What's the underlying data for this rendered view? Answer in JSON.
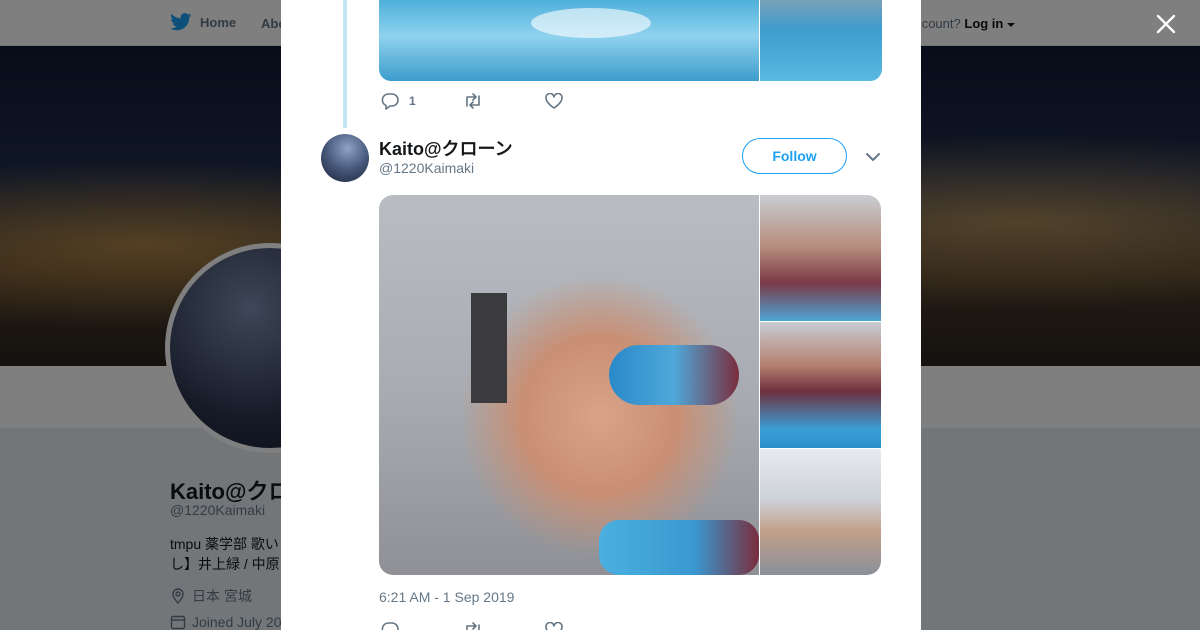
{
  "background_page": {
    "nav": {
      "home": "Home",
      "about": "Abo",
      "account_prompt": "ccount?",
      "login": "Log in"
    },
    "profile": {
      "name": "Kaito@クロ",
      "handle": "@1220Kaimaki",
      "bio": "tmpu 薬学部 歌い し】井上緑 / 中原",
      "location": "日本 宮城",
      "joined": "Joined July 20"
    }
  },
  "modal": {
    "previous_tweet": {
      "reply_count": "1"
    },
    "tweet": {
      "author_name": "Kaito@クローン",
      "author_handle": "@1220Kaimaki",
      "follow_label": "Follow",
      "timestamp": "6:21 AM - 1 Sep 2019"
    }
  },
  "colors": {
    "accent": "#1da1f2",
    "muted": "#657786",
    "text": "#14171a",
    "overlay": "rgba(0,0,0,0.5)"
  },
  "icons": [
    "twitter-bird-icon",
    "caret-down-icon",
    "close-icon",
    "reply-icon",
    "retweet-icon",
    "like-icon",
    "location-icon",
    "calendar-icon"
  ]
}
